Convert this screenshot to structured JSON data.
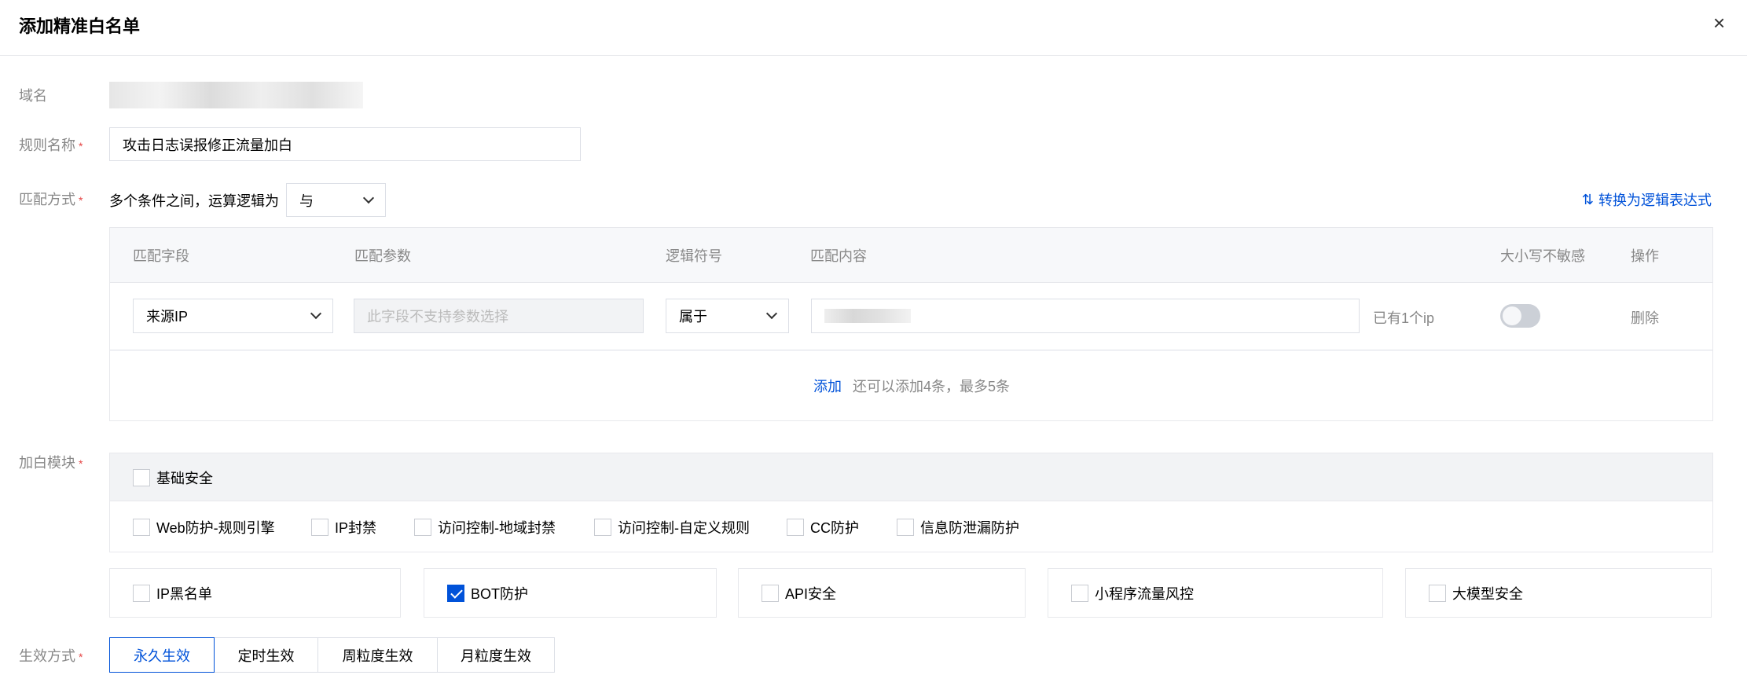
{
  "dialog": {
    "title": "添加精准白名单",
    "close_icon": "×"
  },
  "form": {
    "domain_label": "域名",
    "rule_name_label": "规则名称",
    "rule_name_value": "攻击日志误报修正流量加白",
    "match_label": "匹配方式",
    "match_logic_text": "多个条件之间，运算逻辑为",
    "match_logic_value": "与",
    "convert_link": "转换为逻辑表达式",
    "required_mark": "*"
  },
  "table": {
    "headers": [
      "匹配字段",
      "匹配参数",
      "逻辑符号",
      "匹配内容",
      "大小写不敏感",
      "操作"
    ],
    "row": {
      "field": "来源IP",
      "param_placeholder": "此字段不支持参数选择",
      "operator": "属于",
      "count_text": "已有1个ip",
      "case_insensitive": false,
      "delete": "删除"
    },
    "add_link": "添加",
    "add_hint": "还可以添加4条，最多5条"
  },
  "modules": {
    "label": "加白模块",
    "base": {
      "label": "基础安全",
      "checked": false
    },
    "sub": [
      {
        "label": "Web防护-规则引擎",
        "checked": false
      },
      {
        "label": "IP封禁",
        "checked": false
      },
      {
        "label": "访问控制-地域封禁",
        "checked": false
      },
      {
        "label": "访问控制-自定义规则",
        "checked": false
      },
      {
        "label": "CC防护",
        "checked": false
      },
      {
        "label": "信息防泄漏防护",
        "checked": false
      }
    ],
    "cards": [
      {
        "label": "IP黑名单",
        "checked": false
      },
      {
        "label": "BOT防护",
        "checked": true
      },
      {
        "label": "API安全",
        "checked": false
      },
      {
        "label": "小程序流量风控",
        "checked": false
      },
      {
        "label": "大模型安全",
        "checked": false
      }
    ]
  },
  "effect": {
    "label": "生效方式",
    "options": [
      "永久生效",
      "定时生效",
      "周粒度生效",
      "月粒度生效"
    ],
    "selected": "永久生效"
  },
  "colors": {
    "accent": "#0052d9",
    "required": "#e54545"
  }
}
